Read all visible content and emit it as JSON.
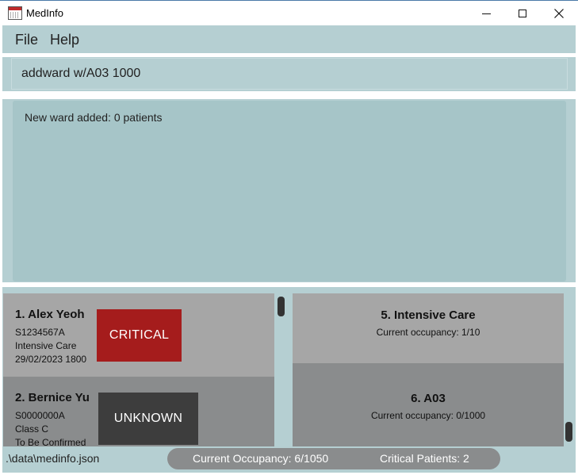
{
  "window": {
    "title": "MedInfo",
    "icon": "calendar-app-icon",
    "controls": [
      "minimize-icon",
      "maximize-icon",
      "close-icon"
    ]
  },
  "menu": {
    "file": "File",
    "help": "Help"
  },
  "command": {
    "value": "addward w/A03 1000"
  },
  "result": {
    "message": "New ward added: 0 patients"
  },
  "patients": [
    {
      "index_name": "1.  Alex Yeoh",
      "nric": "S1234567A",
      "ward": "Intensive Care",
      "discharge": "29/02/2023 1800",
      "status": "CRITICAL",
      "status_color": "#a51c1c"
    },
    {
      "index_name": "2.  Bernice Yu",
      "nric": "S0000000A",
      "ward": "Class C",
      "discharge": "To Be Confirmed",
      "status": "UNKNOWN",
      "status_color": "#3d3d3d"
    }
  ],
  "wards": [
    {
      "index_name": "5.  Intensive Care",
      "occupancy": "Current occupancy: 1/10"
    },
    {
      "index_name": "6.  A03",
      "occupancy": "Current occupancy: 0/1000"
    }
  ],
  "status_bar": {
    "path": ".\\data\\medinfo.json",
    "occupancy": "Current Occupancy: 6/1050",
    "critical": "Critical Patients: 2"
  },
  "colors": {
    "background": "#b5cfd2",
    "result_box": "#a6c5c8",
    "card_light": "#a6a6a6",
    "card_dark": "#8a8c8d"
  }
}
